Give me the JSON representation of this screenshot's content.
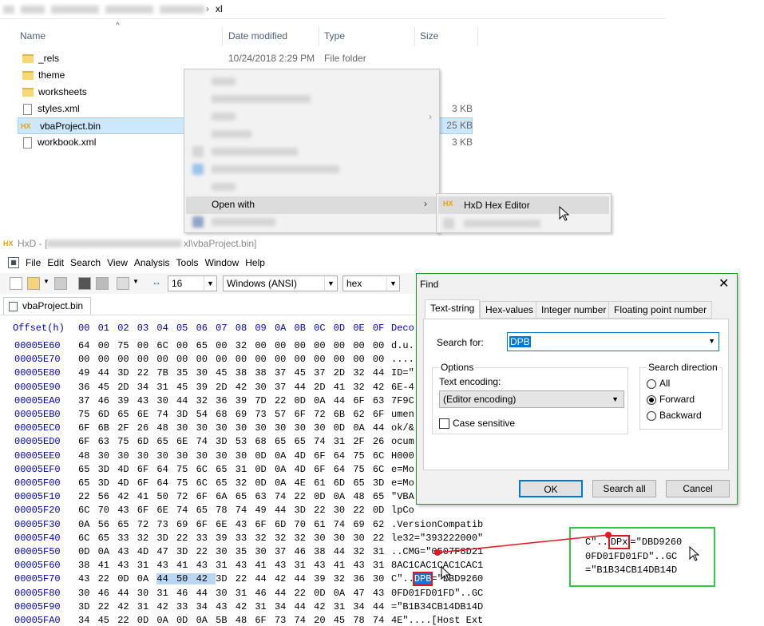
{
  "explorer": {
    "breadcrumb_current": "xl",
    "columns": {
      "name": "Name",
      "date": "Date modified",
      "type": "Type",
      "size": "Size"
    },
    "files": [
      {
        "name": "_rels",
        "kind": "folder",
        "date": "10/24/2018 2:29 PM",
        "type": "File folder",
        "size": ""
      },
      {
        "name": "theme",
        "kind": "folder",
        "date": "",
        "type": "",
        "size": ""
      },
      {
        "name": "worksheets",
        "kind": "folder",
        "date": "",
        "type": "",
        "size": ""
      },
      {
        "name": "styles.xml",
        "kind": "file",
        "date": "",
        "type": "",
        "size": "3 KB"
      },
      {
        "name": "vbaProject.bin",
        "kind": "bin",
        "date": "",
        "type": "",
        "size": "25 KB"
      },
      {
        "name": "workbook.xml",
        "kind": "file",
        "date": "",
        "type": "",
        "size": "3 KB"
      }
    ],
    "context_menu": {
      "open_with": "Open with",
      "submenu_item": "HxD Hex Editor"
    }
  },
  "hxd": {
    "title_suffix": "xl\\vbaProject.bin]",
    "title_prefix": "HxD - [",
    "menu": [
      "File",
      "Edit",
      "Search",
      "View",
      "Analysis",
      "Tools",
      "Window",
      "Help"
    ],
    "toolbar": {
      "bytes_per_row": "16",
      "encoding": "Windows (ANSI)",
      "format": "hex"
    },
    "doc_tab": "vbaProject.bin",
    "header": {
      "offset": "Offset(h)",
      "cols": [
        "00",
        "01",
        "02",
        "03",
        "04",
        "05",
        "06",
        "07",
        "08",
        "09",
        "0A",
        "0B",
        "0C",
        "0D",
        "0E",
        "0F"
      ],
      "decoded": "Deco"
    },
    "rows": [
      {
        "off": "00005E60",
        "hex": [
          "64",
          "00",
          "75",
          "00",
          "6C",
          "00",
          "65",
          "00",
          "32",
          "00",
          "00",
          "00",
          "00",
          "00",
          "00",
          "00"
        ],
        "txt": "d.u."
      },
      {
        "off": "00005E70",
        "hex": [
          "00",
          "00",
          "00",
          "00",
          "00",
          "00",
          "00",
          "00",
          "00",
          "00",
          "00",
          "00",
          "00",
          "00",
          "00",
          "00"
        ],
        "txt": "...."
      },
      {
        "off": "00005E80",
        "hex": [
          "49",
          "44",
          "3D",
          "22",
          "7B",
          "35",
          "30",
          "45",
          "38",
          "38",
          "37",
          "45",
          "37",
          "2D",
          "32",
          "44"
        ],
        "txt": "ID=\""
      },
      {
        "off": "00005E90",
        "hex": [
          "36",
          "45",
          "2D",
          "34",
          "31",
          "45",
          "39",
          "2D",
          "42",
          "30",
          "37",
          "44",
          "2D",
          "41",
          "32",
          "42"
        ],
        "txt": "6E-4"
      },
      {
        "off": "00005EA0",
        "hex": [
          "37",
          "46",
          "39",
          "43",
          "30",
          "44",
          "32",
          "36",
          "39",
          "7D",
          "22",
          "0D",
          "0A",
          "44",
          "6F",
          "63"
        ],
        "txt": "7F9C"
      },
      {
        "off": "00005EB0",
        "hex": [
          "75",
          "6D",
          "65",
          "6E",
          "74",
          "3D",
          "54",
          "68",
          "69",
          "73",
          "57",
          "6F",
          "72",
          "6B",
          "62",
          "6F"
        ],
        "txt": "umen"
      },
      {
        "off": "00005EC0",
        "hex": [
          "6F",
          "6B",
          "2F",
          "26",
          "48",
          "30",
          "30",
          "30",
          "30",
          "30",
          "30",
          "30",
          "30",
          "0D",
          "0A",
          "44"
        ],
        "txt": "ok/&"
      },
      {
        "off": "00005ED0",
        "hex": [
          "6F",
          "63",
          "75",
          "6D",
          "65",
          "6E",
          "74",
          "3D",
          "53",
          "68",
          "65",
          "65",
          "74",
          "31",
          "2F",
          "26"
        ],
        "txt": "ocum"
      },
      {
        "off": "00005EE0",
        "hex": [
          "48",
          "30",
          "30",
          "30",
          "30",
          "30",
          "30",
          "30",
          "30",
          "0D",
          "0A",
          "4D",
          "6F",
          "64",
          "75",
          "6C"
        ],
        "txt": "H000"
      },
      {
        "off": "00005EF0",
        "hex": [
          "65",
          "3D",
          "4D",
          "6F",
          "64",
          "75",
          "6C",
          "65",
          "31",
          "0D",
          "0A",
          "4D",
          "6F",
          "64",
          "75",
          "6C"
        ],
        "txt": "e=Mo"
      },
      {
        "off": "00005F00",
        "hex": [
          "65",
          "3D",
          "4D",
          "6F",
          "64",
          "75",
          "6C",
          "65",
          "32",
          "0D",
          "0A",
          "4E",
          "61",
          "6D",
          "65",
          "3D"
        ],
        "txt": "e=Mo"
      },
      {
        "off": "00005F10",
        "hex": [
          "22",
          "56",
          "42",
          "41",
          "50",
          "72",
          "6F",
          "6A",
          "65",
          "63",
          "74",
          "22",
          "0D",
          "0A",
          "48",
          "65"
        ],
        "txt": "\"VBA"
      },
      {
        "off": "00005F20",
        "hex": [
          "6C",
          "70",
          "43",
          "6F",
          "6E",
          "74",
          "65",
          "78",
          "74",
          "49",
          "44",
          "3D",
          "22",
          "30",
          "22",
          "0D"
        ],
        "txt": "lpCo"
      },
      {
        "off": "00005F30",
        "hex": [
          "0A",
          "56",
          "65",
          "72",
          "73",
          "69",
          "6F",
          "6E",
          "43",
          "6F",
          "6D",
          "70",
          "61",
          "74",
          "69",
          "62"
        ],
        "txt": ".VersionCompatib"
      },
      {
        "off": "00005F40",
        "hex": [
          "6C",
          "65",
          "33",
          "32",
          "3D",
          "22",
          "33",
          "39",
          "33",
          "32",
          "32",
          "32",
          "30",
          "30",
          "30",
          "22"
        ],
        "txt": "le32=\"393222000\""
      },
      {
        "off": "00005F50",
        "hex": [
          "0D",
          "0A",
          "43",
          "4D",
          "47",
          "3D",
          "22",
          "30",
          "35",
          "30",
          "37",
          "46",
          "38",
          "44",
          "32",
          "31"
        ],
        "txt": "..CMG=\"0507F8D21"
      },
      {
        "off": "00005F60",
        "hex": [
          "38",
          "41",
          "43",
          "31",
          "43",
          "41",
          "43",
          "31",
          "43",
          "41",
          "43",
          "31",
          "43",
          "41",
          "43",
          "31"
        ],
        "txt": "8AC1CAC1CAC1CAC1"
      },
      {
        "off": "00005F70",
        "hex": [
          "43",
          "22",
          "0D",
          "0A",
          "44",
          "50",
          "42",
          "3D",
          "22",
          "44",
          "42",
          "44",
          "39",
          "32",
          "36",
          "30"
        ],
        "txt_pre": "C\"..",
        "txt_sel": "DPB",
        "txt_post": "=\"DBD9260"
      },
      {
        "off": "00005F80",
        "hex": [
          "30",
          "46",
          "44",
          "30",
          "31",
          "46",
          "44",
          "30",
          "31",
          "46",
          "44",
          "22",
          "0D",
          "0A",
          "47",
          "43"
        ],
        "txt": "0FD01FD01FD\"..GC"
      },
      {
        "off": "00005F90",
        "hex": [
          "3D",
          "22",
          "42",
          "31",
          "42",
          "33",
          "34",
          "43",
          "42",
          "31",
          "34",
          "44",
          "42",
          "31",
          "34",
          "44"
        ],
        "txt": "=\"B1B34CB14DB14D"
      },
      {
        "off": "00005FA0",
        "hex": [
          "34",
          "45",
          "22",
          "0D",
          "0A",
          "0D",
          "0A",
          "5B",
          "48",
          "6F",
          "73",
          "74",
          "20",
          "45",
          "78",
          "74"
        ],
        "txt": "4E\"....[Host Ext"
      }
    ],
    "highlight_row": 17,
    "highlight_cols": [
      4,
      5,
      6
    ]
  },
  "find": {
    "title": "Find",
    "tabs": [
      "Text-string",
      "Hex-values",
      "Integer number",
      "Floating point number"
    ],
    "search_label": "Search for:",
    "search_value": "DPB",
    "options_label": "Options",
    "encoding_label": "Text encoding:",
    "encoding_value": "(Editor encoding)",
    "case_label": "Case sensitive",
    "direction_label": "Search direction",
    "directions": [
      "All",
      "Forward",
      "Backward"
    ],
    "ok": "OK",
    "search_all": "Search all",
    "cancel": "Cancel"
  },
  "zoom": {
    "line1_pre": "C\"..",
    "line1_box": "DPx",
    "line1_post": "=\"DBD9260",
    "line2": "0FD01FD01FD\"..GC",
    "line3": "=\"B1B34CB14DB14D"
  },
  "colors": {
    "accent_green": "#2ecc40",
    "annotation_red": "#e8141c",
    "selection": "#1c6fd3"
  }
}
